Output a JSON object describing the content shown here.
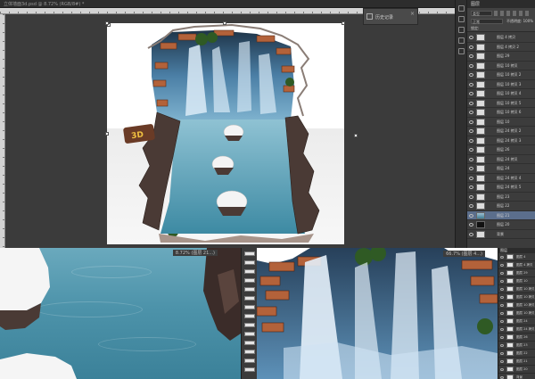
{
  "window": {
    "title": "立体墙面3d.psd @ 8.72% (RGB/8#) *"
  },
  "history_panel": {
    "label": "历史记录"
  },
  "layers_panel": {
    "tab_label": "图层",
    "kind_filter": "类型",
    "blend_mode": "正常",
    "opacity_label": "不透明度: 100%",
    "lock_label": "锁定:",
    "fill_label": "填充: 100%",
    "layers": [
      {
        "name": "图层 4 拷贝",
        "thumb": "light"
      },
      {
        "name": "图层 4 拷贝 2",
        "thumb": "light"
      },
      {
        "name": "图层 29",
        "thumb": "light"
      },
      {
        "name": "图层 10 拷贝",
        "thumb": "light"
      },
      {
        "name": "图层 10 拷贝 2",
        "thumb": "light"
      },
      {
        "name": "图层 10 拷贝 3",
        "thumb": "light"
      },
      {
        "name": "图层 10 拷贝 4",
        "thumb": "light"
      },
      {
        "name": "图层 10 拷贝 5",
        "thumb": "light"
      },
      {
        "name": "图层 10 拷贝 6",
        "thumb": "light"
      },
      {
        "name": "图层 10",
        "thumb": "light"
      },
      {
        "name": "图层 24 拷贝 2",
        "thumb": "light"
      },
      {
        "name": "图层 24 拷贝 3",
        "thumb": "light"
      },
      {
        "name": "图层 26",
        "thumb": "light"
      },
      {
        "name": "图层 24 拷贝",
        "thumb": "light"
      },
      {
        "name": "图层 24",
        "thumb": "light"
      },
      {
        "name": "图层 24 拷贝 4",
        "thumb": "light"
      },
      {
        "name": "图层 24 拷贝 5",
        "thumb": "light"
      },
      {
        "name": "图层 23",
        "thumb": "light"
      },
      {
        "name": "图层 22",
        "thumb": "light"
      },
      {
        "name": "图层 21",
        "thumb": "water"
      },
      {
        "name": "图层 20",
        "thumb": "dark"
      },
      {
        "name": "背景",
        "thumb": "light"
      }
    ]
  },
  "water_window": {
    "label": "8.72% (图层 21...)"
  },
  "fall_window": {
    "label": "66.7% (图层 4...)"
  },
  "mini_layers": {
    "tab_label": "图层",
    "rows": [
      "图层 4",
      "图层 4 拷贝",
      "图层 29",
      "图层 10",
      "图层 10 拷贝",
      "图层 10 拷贝 2",
      "图层 10 拷贝 3",
      "图层 10 拷贝 4",
      "图层 24",
      "图层 24 拷贝",
      "图层 26",
      "图层 23",
      "图层 22",
      "图层 21",
      "图层 20",
      "背景"
    ]
  },
  "badge": {
    "text": "3D"
  },
  "colors": {
    "workspace_bg": "#3b3b3b",
    "water": "#4d93aa",
    "waterfall": "#cfe3f5",
    "brick": "#b3623a",
    "selected_layer": "#5b6e8c"
  }
}
